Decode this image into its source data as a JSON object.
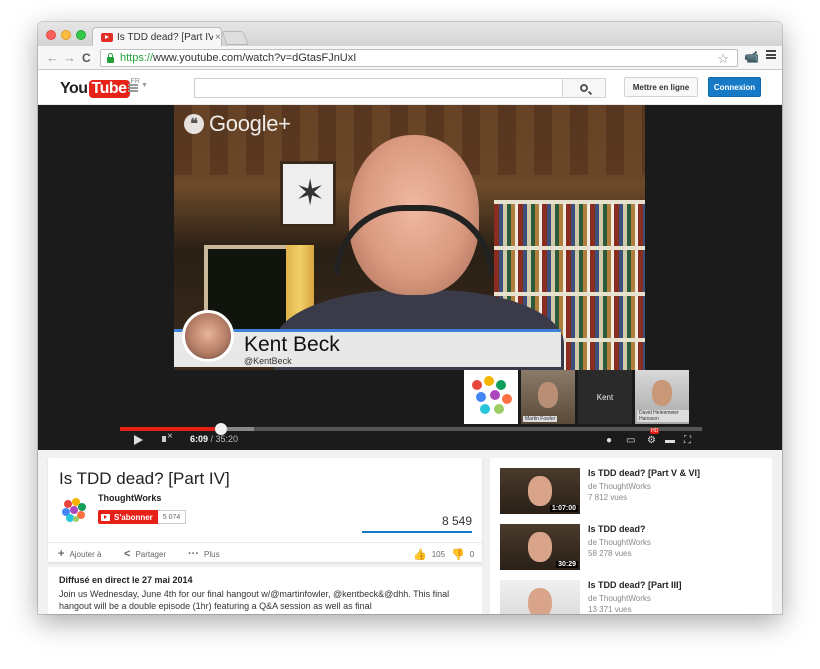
{
  "browser": {
    "tab_title": "Is TDD dead? [Part IV] - You",
    "tab_close": "×",
    "url_scheme": "https://",
    "url_rest": "www.youtube.com/watch?v=dGtasFJnUxI",
    "back_glyph": "←",
    "forward_glyph": "→",
    "reload_glyph": "C",
    "star_glyph": "☆",
    "ext_glyph": "📹"
  },
  "header": {
    "logo_you": "You",
    "logo_tube": "Tube",
    "region": "FR",
    "search_placeholder": "",
    "upload_label": "Mettre en ligne",
    "signin_label": "Connexion"
  },
  "player": {
    "watermark": "Google+",
    "speaker_name": "Kent Beck",
    "speaker_handle": "@KentBeck",
    "participants": [
      {
        "name": ""
      },
      {
        "name": "Martin Fowler"
      },
      {
        "name": "Kent"
      },
      {
        "name": "David Heinemeier Hansson"
      }
    ],
    "current_time": "6:09",
    "duration": "35:20",
    "played_fraction": 0.174,
    "loaded_fraction": 0.23,
    "hd_badge": "HD"
  },
  "video": {
    "title": "Is TDD dead? [Part IV]",
    "channel": "ThoughtWorks",
    "subscribe_label": "S'abonner",
    "subscriber_count": "5 074",
    "views": "8 549",
    "actions": {
      "add_to": "Ajouter à",
      "share": "Partager",
      "more": "Plus"
    },
    "likes": "105",
    "dislikes": "0"
  },
  "description": {
    "date": "Diffusé en direct le 27 mai 2014",
    "text": "Join us Wednesday, June 4th for our final hangout  w/@martinfowler, @kentbeck&@dhh. This final hangout will be a double episode (1hr) featuring a Q&A session as well as final"
  },
  "related": [
    {
      "title": "Is TDD dead? [Part V & VI]",
      "channel": "de ThoughtWorks",
      "views": "7 812 vues",
      "duration": "1:07:00"
    },
    {
      "title": "Is TDD dead?",
      "channel": "de ThoughtWorks",
      "views": "58 278 vues",
      "duration": "30:29"
    },
    {
      "title": "Is TDD dead? [Part III]",
      "channel": "de ThoughtWorks",
      "views": "13 371 vues",
      "duration": ""
    }
  ]
}
